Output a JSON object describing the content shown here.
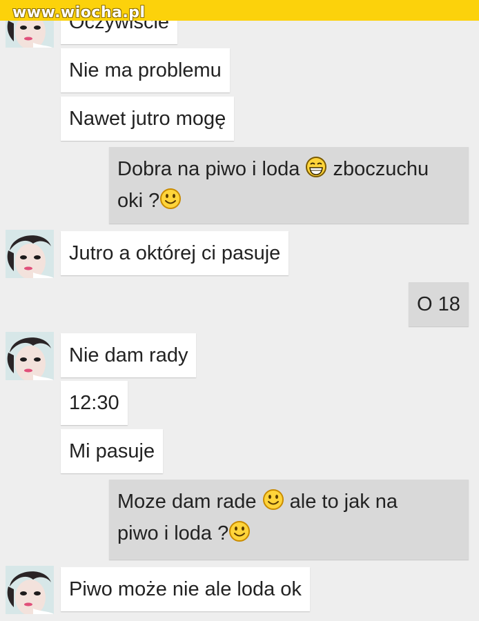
{
  "watermark": "www.wiocha.pl",
  "messages": {
    "m0": "Oczywiście",
    "m1": "Nie ma problemu",
    "m2": "Nawet jutro mogę",
    "m3_a": "Dobra na piwo i loda",
    "m3_b": "zboczuchu",
    "m3_c": "oki ?",
    "m4": "Jutro a októrej ci pasuje",
    "m5": "O 18",
    "m6": "Nie dam rady",
    "m7": "12:30",
    "m8": "Mi pasuje",
    "m9_a": "Moze dam rade",
    "m9_b": "ale to jak na",
    "m9_c": "piwo i loda ?",
    "m10": "Piwo może nie ale loda ok"
  },
  "emoji": {
    "grin": "laughing-emoji",
    "smile": "smiley-emoji"
  },
  "colors": {
    "topbar": "#fcd20b",
    "background": "#eeeeee",
    "incoming": "#ffffff",
    "outgoing": "#d9d9d9"
  }
}
